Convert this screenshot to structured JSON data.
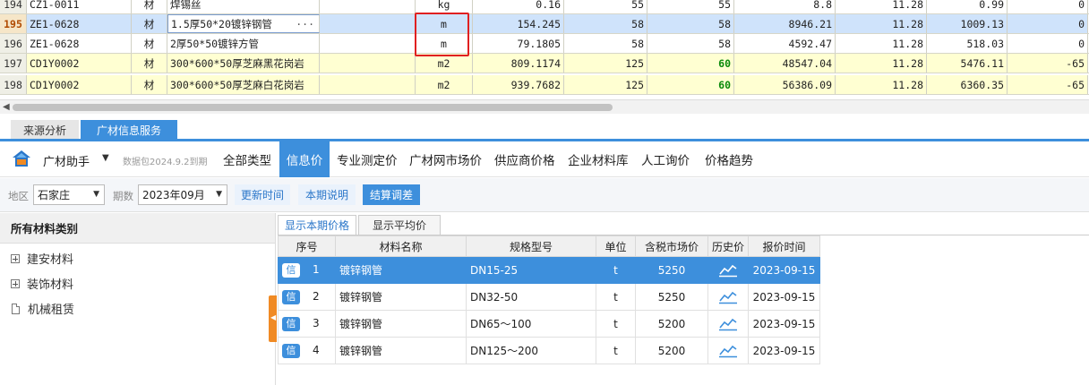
{
  "grid": {
    "rows": [
      {
        "idx": "194",
        "code": "CZ1-0011",
        "type": "材",
        "name": "焊锡丝",
        "unit": "kg",
        "qty": "0.16",
        "c1": "55",
        "c2": "55",
        "amount": "8.8",
        "rate": "11.28",
        "tax": "0.99",
        "diff": "0",
        "style": "white"
      },
      {
        "idx": "195",
        "code": "ZE1-0628",
        "type": "材",
        "name": "1.5厚50*20镀锌钢管",
        "unit": "m",
        "qty": "154.245",
        "c1": "58",
        "c2": "58",
        "amount": "8946.21",
        "rate": "11.28",
        "tax": "1009.13",
        "diff": "0",
        "style": "sel"
      },
      {
        "idx": "196",
        "code": "ZE1-0628",
        "type": "材",
        "name": "2厚50*50镀锌方管",
        "unit": "m",
        "qty": "79.1805",
        "c1": "58",
        "c2": "58",
        "amount": "4592.47",
        "rate": "11.28",
        "tax": "518.03",
        "diff": "0",
        "style": "white"
      },
      {
        "idx": "197",
        "code": "CD1Y0002",
        "type": "材",
        "name": "300*600*50厚芝麻黑花岗岩",
        "unit": "m2",
        "qty": "809.1174",
        "c1": "125",
        "c2": "60",
        "amount": "48547.04",
        "rate": "11.28",
        "tax": "5476.11",
        "diff": "-65",
        "style": "yellow"
      },
      {
        "idx": "198",
        "code": "CD1Y0002",
        "type": "材",
        "name": "300*600*50厚芝麻白花岗岩",
        "unit": "m2",
        "qty": "939.7682",
        "c1": "125",
        "c2": "60",
        "amount": "56386.09",
        "rate": "11.28",
        "tax": "6360.35",
        "diff": "-65",
        "style": "yellow"
      }
    ],
    "ellipsis": "···"
  },
  "tabs": {
    "source": "来源分析",
    "gc_service": "广材信息服务"
  },
  "assistant": {
    "brand": "广材助手",
    "package_note": "数据包2024.9.2到期",
    "nav": [
      "全部类型",
      "信息价",
      "专业测定价",
      "广材网市场价",
      "供应商价格",
      "企业材料库",
      "人工询价",
      "价格趋势"
    ],
    "active_nav": 1
  },
  "filters": {
    "region_label": "地区",
    "region_value": "石家庄",
    "period_label": "期数",
    "period_value": "2023年09月",
    "btn_update": "更新时间",
    "btn_notes": "本期说明",
    "btn_settle": "结算调差"
  },
  "categories": {
    "header": "所有材料类别",
    "items": [
      "建安材料",
      "装饰材料",
      "机械租赁"
    ]
  },
  "prices": {
    "subtabs": [
      "显示本期价格",
      "显示平均价"
    ],
    "columns": [
      "序号",
      "材料名称",
      "规格型号",
      "单位",
      "含税市场价",
      "历史价",
      "报价时间"
    ],
    "badge": "信",
    "rows": [
      {
        "no": "1",
        "name": "镀锌钢管",
        "spec": "DN15-25",
        "unit": "t",
        "price": "5250",
        "date": "2023-09-15"
      },
      {
        "no": "2",
        "name": "镀锌钢管",
        "spec": "DN32-50",
        "unit": "t",
        "price": "5250",
        "date": "2023-09-15"
      },
      {
        "no": "3",
        "name": "镀锌钢管",
        "spec": "DN65～100",
        "unit": "t",
        "price": "5200",
        "date": "2023-09-15"
      },
      {
        "no": "4",
        "name": "镀锌钢管",
        "spec": "DN125～200",
        "unit": "t",
        "price": "5200",
        "date": "2023-09-15"
      }
    ]
  },
  "colors": {
    "accent": "#3d8fdc",
    "highlight_border": "#e02020",
    "handle": "#f08a24"
  }
}
